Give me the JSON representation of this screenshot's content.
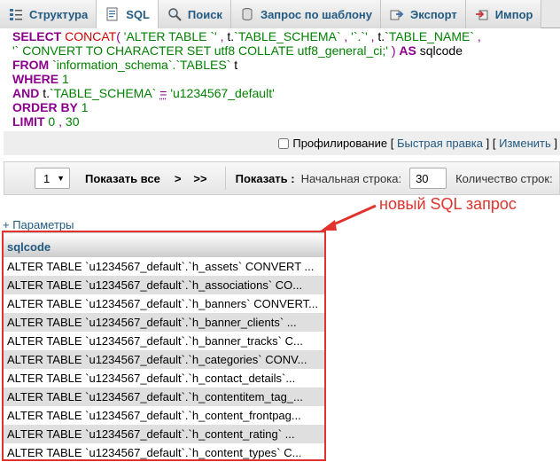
{
  "tabs": [
    {
      "label": "Структура",
      "icon": "structure-icon"
    },
    {
      "label": "SQL",
      "icon": "sql-icon",
      "active": true
    },
    {
      "label": "Поиск",
      "icon": "search-icon"
    },
    {
      "label": "Запрос по шаблону",
      "icon": "query-template-icon"
    },
    {
      "label": "Экспорт",
      "icon": "export-icon"
    },
    {
      "label": "Импор",
      "icon": "import-icon"
    }
  ],
  "sql": {
    "l1": {
      "kw": "SELECT",
      "fn": "CONCAT",
      "p1": "( ",
      "s1": "'ALTER TABLE `'",
      "c1": " , ",
      "t1": "t.",
      "s2": "`TABLE_SCHEMA`",
      "c2": " , ",
      "s3": "'`.`'",
      "c3": " , ",
      "t2": "t.",
      "s4": "`TABLE_NAME`",
      "c4": " ,"
    },
    "l2": {
      "s": "'` CONVERT TO CHARACTER SET utf8 COLLATE utf8_general_ci;'",
      "p": " ) ",
      "kw": "AS",
      "a": " sqlcode"
    },
    "l3": {
      "kw": "FROM",
      "s": " `information_schema`.`TABLES`",
      "a": " t"
    },
    "l4": {
      "kw": "WHERE",
      "n": " 1"
    },
    "l5": {
      "kw": "AND",
      "t": " t.",
      "s": "`TABLE_SCHEMA`",
      "op": "=",
      "v": "'u1234567_default'"
    },
    "l6": {
      "kw": "ORDER BY",
      "n": " 1"
    },
    "l7": {
      "kw": "LIMIT",
      "n1": " 0",
      "c": " , ",
      "n2": "30"
    }
  },
  "profiling": {
    "label": "Профилирование",
    "open": "[",
    "quick_edit": "Быстрая правка",
    "mid": "] [",
    "edit": "Изменить",
    "close": "]"
  },
  "nav": {
    "page_value": "1",
    "show_all": "Показать все",
    "next": ">",
    "last": ">>",
    "show_label": "Показать :",
    "start_row_label": "Начальная строка:",
    "start_row_value": "30",
    "row_count_label": "Количество строк:"
  },
  "params_link": "+ Параметры",
  "annotation": "новый SQL запрос",
  "result": {
    "header": "sqlcode",
    "rows": [
      "ALTER TABLE `u1234567_default`.`h_assets` CONVERT ...",
      "ALTER TABLE `u1234567_default`.`h_associations` CO...",
      "ALTER TABLE `u1234567_default`.`h_banners` CONVERT...",
      "ALTER TABLE `u1234567_default`.`h_banner_clients` ...",
      "ALTER TABLE `u1234567_default`.`h_banner_tracks` C...",
      "ALTER TABLE `u1234567_default`.`h_categories` CONV...",
      "ALTER TABLE `u1234567_default`.`h_contact_details`...",
      "ALTER TABLE `u1234567_default`.`h_contentitem_tag_...",
      "ALTER TABLE `u1234567_default`.`h_content_frontpag...",
      "ALTER TABLE `u1234567_default`.`h_content_rating` ...",
      "ALTER TABLE `u1234567_default`.`h_content_types` C..."
    ]
  },
  "colors": {
    "link": "#235a81",
    "keyword": "#8b008b",
    "string": "#008000",
    "function": "#cc0000",
    "annotation": "#e2322e"
  }
}
